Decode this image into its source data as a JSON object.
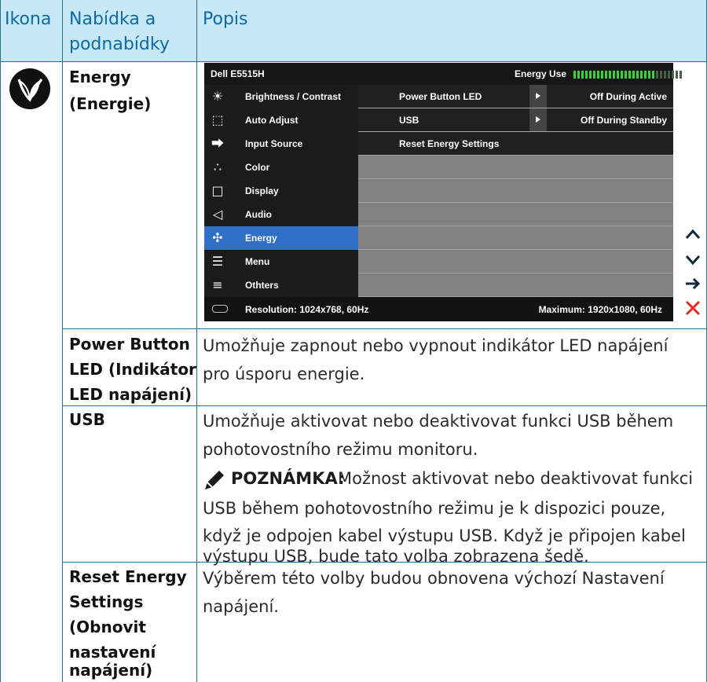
{
  "header": {
    "col1": "Ikona",
    "col2_line1": "Nabídka a",
    "col2_line2": "podnabídky",
    "col3": "Popis"
  },
  "energy_row": {
    "menu_line1": "Energy",
    "menu_line2": "(Energie)",
    "icon": "energy-leaf-icon"
  },
  "osd": {
    "title": "Dell E5515H",
    "energy_label": "Energy Use",
    "energy_level": 0.75,
    "menu_items": [
      {
        "label": "Brightness / Contrast",
        "icon": "brightness-icon"
      },
      {
        "label": "Auto Adjust",
        "icon": "auto-adjust-icon"
      },
      {
        "label": "Input Source",
        "icon": "input-source-icon"
      },
      {
        "label": "Color",
        "icon": "color-icon"
      },
      {
        "label": "Display",
        "icon": "display-icon"
      },
      {
        "label": "Audio",
        "icon": "audio-icon"
      },
      {
        "label": "Energy",
        "icon": "energy-icon",
        "selected": true
      },
      {
        "label": "Menu",
        "icon": "menu-icon"
      },
      {
        "label": "Othters",
        "icon": "others-icon"
      }
    ],
    "sub_rows": [
      {
        "label": "Power Button LED",
        "value": "Off During Active",
        "arrow": true
      },
      {
        "label": "USB",
        "value": "Off During Standby",
        "arrow": true
      },
      {
        "label": "Reset Energy Settings",
        "value": "",
        "arrow": false
      }
    ],
    "resolution": "Resolution: 1024x768, 60Hz",
    "maximum": "Maximum: 1920x1080, 60Hz",
    "selected_color": "#2f6fc5"
  },
  "side_buttons": [
    "up-arrow-icon",
    "down-arrow-icon",
    "right-arrow-icon",
    "close-icon"
  ],
  "rows": {
    "power_led": {
      "name_lines": [
        "Power Button",
        "LED (Indikátor",
        "LED napájení)"
      ],
      "desc_lines": [
        "Umožňuje zapnout nebo vypnout indikátor LED napájení",
        "pro úsporu energie."
      ]
    },
    "usb": {
      "name_lines": [
        "USB"
      ],
      "desc_lines": [
        "Umožňuje aktivovat nebo deaktivovat funkci USB během",
        "pohotovostního režimu monitoru."
      ],
      "note_label": "POZNÁMKA:",
      "note_first": "Možnost aktivovat nebo deaktivovat funkci",
      "note_lines": [
        "USB během pohotovostního režimu je k dispozici pouze,",
        "když je odpojen kabel výstupu USB. Když je připojen kabel",
        "výstupu USB, bude tato volba zobrazena šedě."
      ]
    },
    "reset": {
      "name_lines": [
        "Reset Energy",
        "Settings",
        "(Obnovit",
        "nastavení",
        "napájení)"
      ],
      "desc_lines": [
        "Výběrem této volby budou obnovena výchozí Nastavení",
        "napájení."
      ]
    }
  }
}
